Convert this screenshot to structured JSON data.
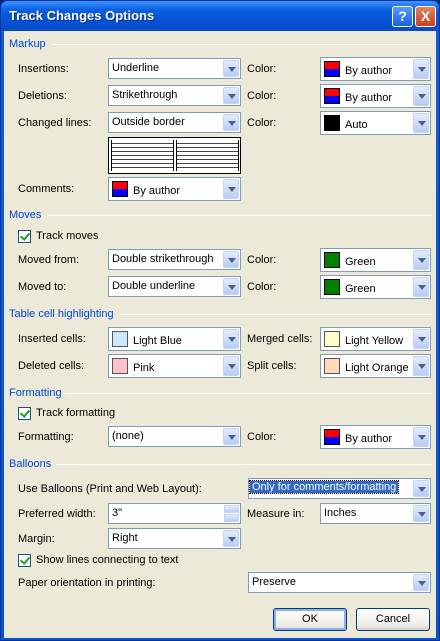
{
  "title": "Track Changes Options",
  "title_buttons": {
    "help": "?",
    "close": "X"
  },
  "markup": {
    "group": "Markup",
    "insertions_label": "Insertions:",
    "insertions_value": "Underline",
    "deletions_label": "Deletions:",
    "deletions_value": "Strikethrough",
    "changed_label": "Changed lines:",
    "changed_value": "Outside border",
    "comments_label": "Comments:",
    "comments_value": "By author",
    "color_label": "Color:",
    "ins_color": "By author",
    "del_color": "By author",
    "changed_color": "Auto"
  },
  "moves": {
    "group": "Moves",
    "track_label": "Track moves",
    "track_checked": true,
    "from_label": "Moved from:",
    "from_value": "Double strikethrough",
    "to_label": "Moved to:",
    "to_value": "Double underline",
    "color_label": "Color:",
    "from_color": "Green",
    "to_color": "Green"
  },
  "table": {
    "group": "Table cell highlighting",
    "inserted_label": "Inserted cells:",
    "inserted_value": "Light Blue",
    "deleted_label": "Deleted cells:",
    "deleted_value": "Pink",
    "merged_label": "Merged cells:",
    "merged_value": "Light Yellow",
    "split_label": "Split cells:",
    "split_value": "Light Orange"
  },
  "formatting": {
    "group": "Formatting",
    "track_label": "Track formatting",
    "track_checked": true,
    "fmt_label": "Formatting:",
    "fmt_value": "(none)",
    "color_label": "Color:",
    "color_value": "By author"
  },
  "balloons": {
    "group": "Balloons",
    "use_label": "Use Balloons (Print and Web Layout):",
    "use_value": "Only for comments/formatting",
    "width_label": "Preferred width:",
    "width_value": "3\"",
    "measure_label": "Measure in:",
    "measure_value": "Inches",
    "margin_label": "Margin:",
    "margin_value": "Right",
    "lines_label": "Show lines connecting to text",
    "lines_checked": true,
    "orient_label": "Paper orientation in printing:",
    "orient_value": "Preserve"
  },
  "buttons": {
    "ok": "OK",
    "cancel": "Cancel"
  },
  "colors": {
    "accent": "#0046d5",
    "title_bar": "#0a5fe0",
    "dialog_bg": "#ece9d8"
  }
}
